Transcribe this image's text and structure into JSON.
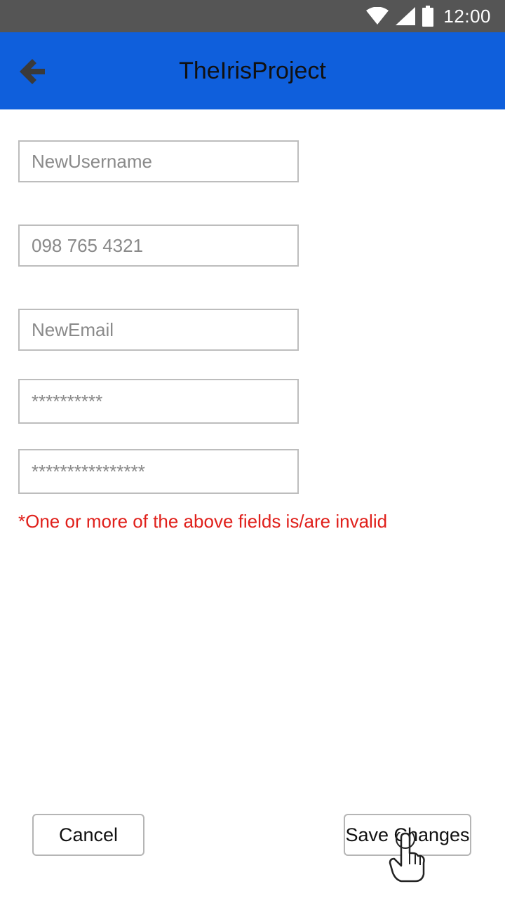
{
  "status_bar": {
    "time": "12:00",
    "icons": [
      "wifi-icon",
      "cell-signal-icon",
      "battery-icon"
    ]
  },
  "app_bar": {
    "title": "TheIrisProject",
    "back_icon": "arrow-left-icon",
    "background_color": "#0f5fdc"
  },
  "form": {
    "username": {
      "placeholder": "NewUsername"
    },
    "phone": {
      "placeholder": "098 765 4321"
    },
    "email": {
      "placeholder": "NewEmail"
    },
    "password": {
      "placeholder": "**********"
    },
    "confirm_password": {
      "placeholder": "****************"
    },
    "error_message": "*One or more of the above fields is/are invalid",
    "error_color": "#e0201b"
  },
  "buttons": {
    "cancel_label": "Cancel",
    "save_label": "Save Changes"
  },
  "cursor": {
    "icon": "hand-pointer-icon"
  }
}
